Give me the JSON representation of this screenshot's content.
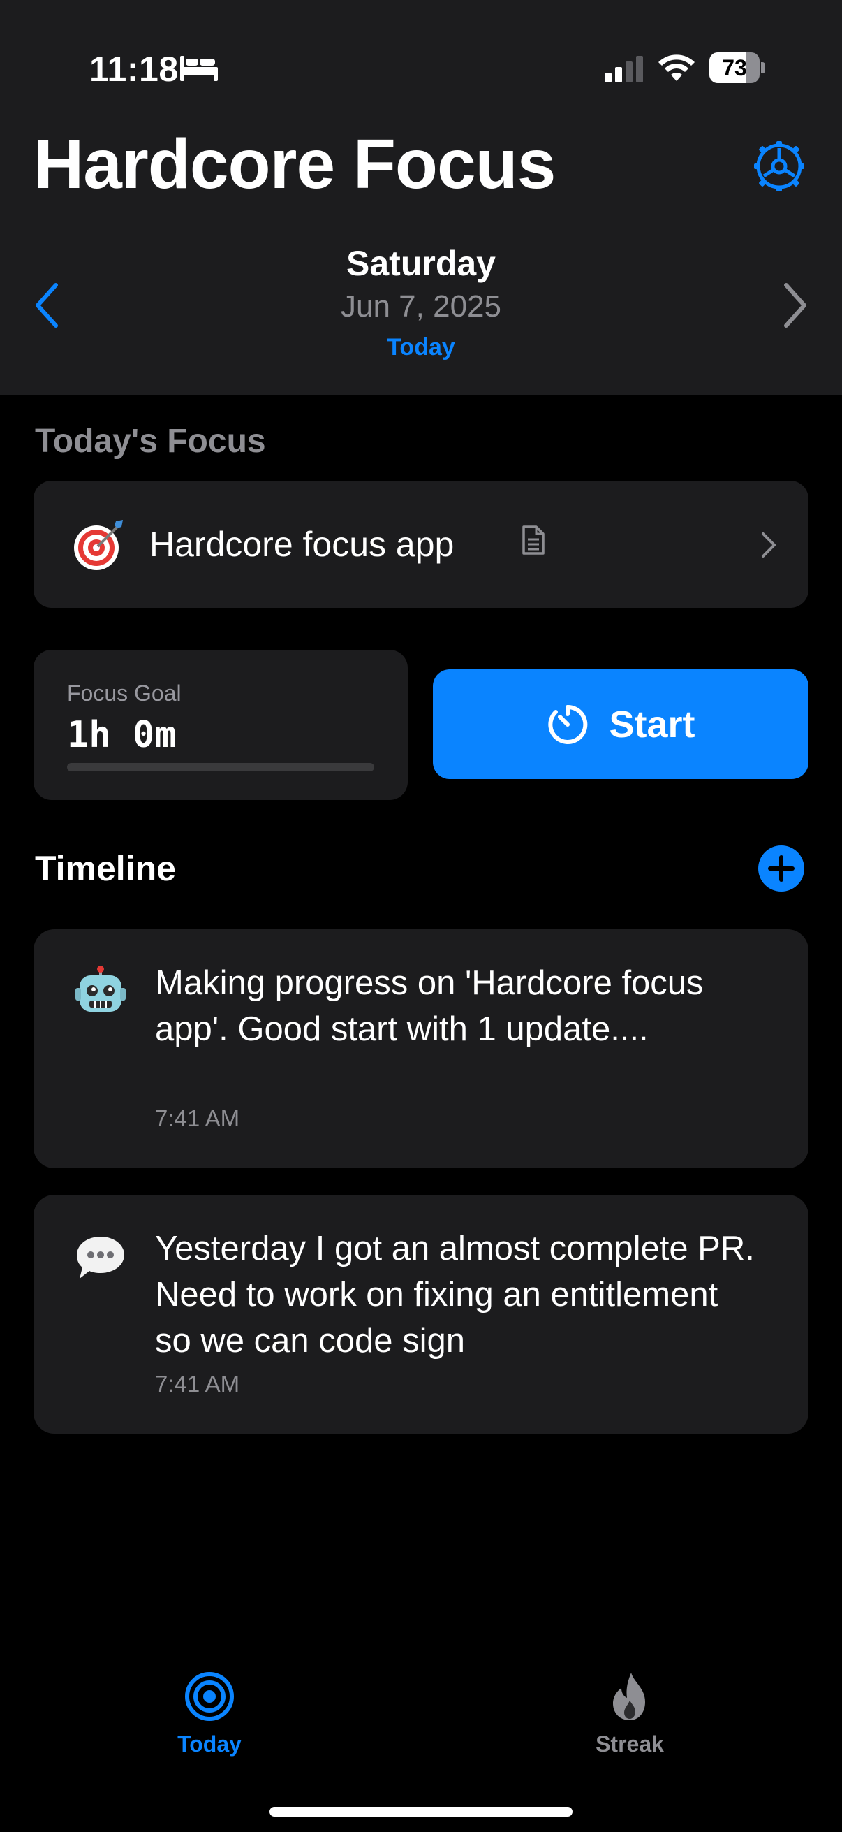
{
  "status_bar": {
    "time": "11:18",
    "battery_level": "73",
    "battery_fraction": 0.73
  },
  "header": {
    "title": "Hardcore Focus",
    "settings_icon": "gear-icon",
    "day_name": "Saturday",
    "date": "Jun 7, 2025",
    "today_label": "Today"
  },
  "focus": {
    "section_label": "Today's Focus",
    "emoji": "🎯",
    "title": "Hardcore focus app"
  },
  "goal": {
    "label": "Focus Goal",
    "value": "1h 0m",
    "progress": 0
  },
  "start_button": {
    "label": "Start"
  },
  "timeline": {
    "title": "Timeline",
    "entries": [
      {
        "emoji": "🤖",
        "text": "Making progress on 'Hardcore focus app'. Good start with 1 update....",
        "time": "7:41 AM"
      },
      {
        "emoji": "💬",
        "text": "Yesterday I got an almost complete PR. Need to work on fixing an entitlement so we can code sign",
        "time": "7:41 AM"
      }
    ]
  },
  "tabs": [
    {
      "label": "Today",
      "icon": "target-icon"
    },
    {
      "label": "Streak",
      "icon": "flame-icon"
    }
  ],
  "colors": {
    "accent": "#0a84ff",
    "card": "#1c1c1e",
    "secondary_text": "#8e8e93"
  }
}
